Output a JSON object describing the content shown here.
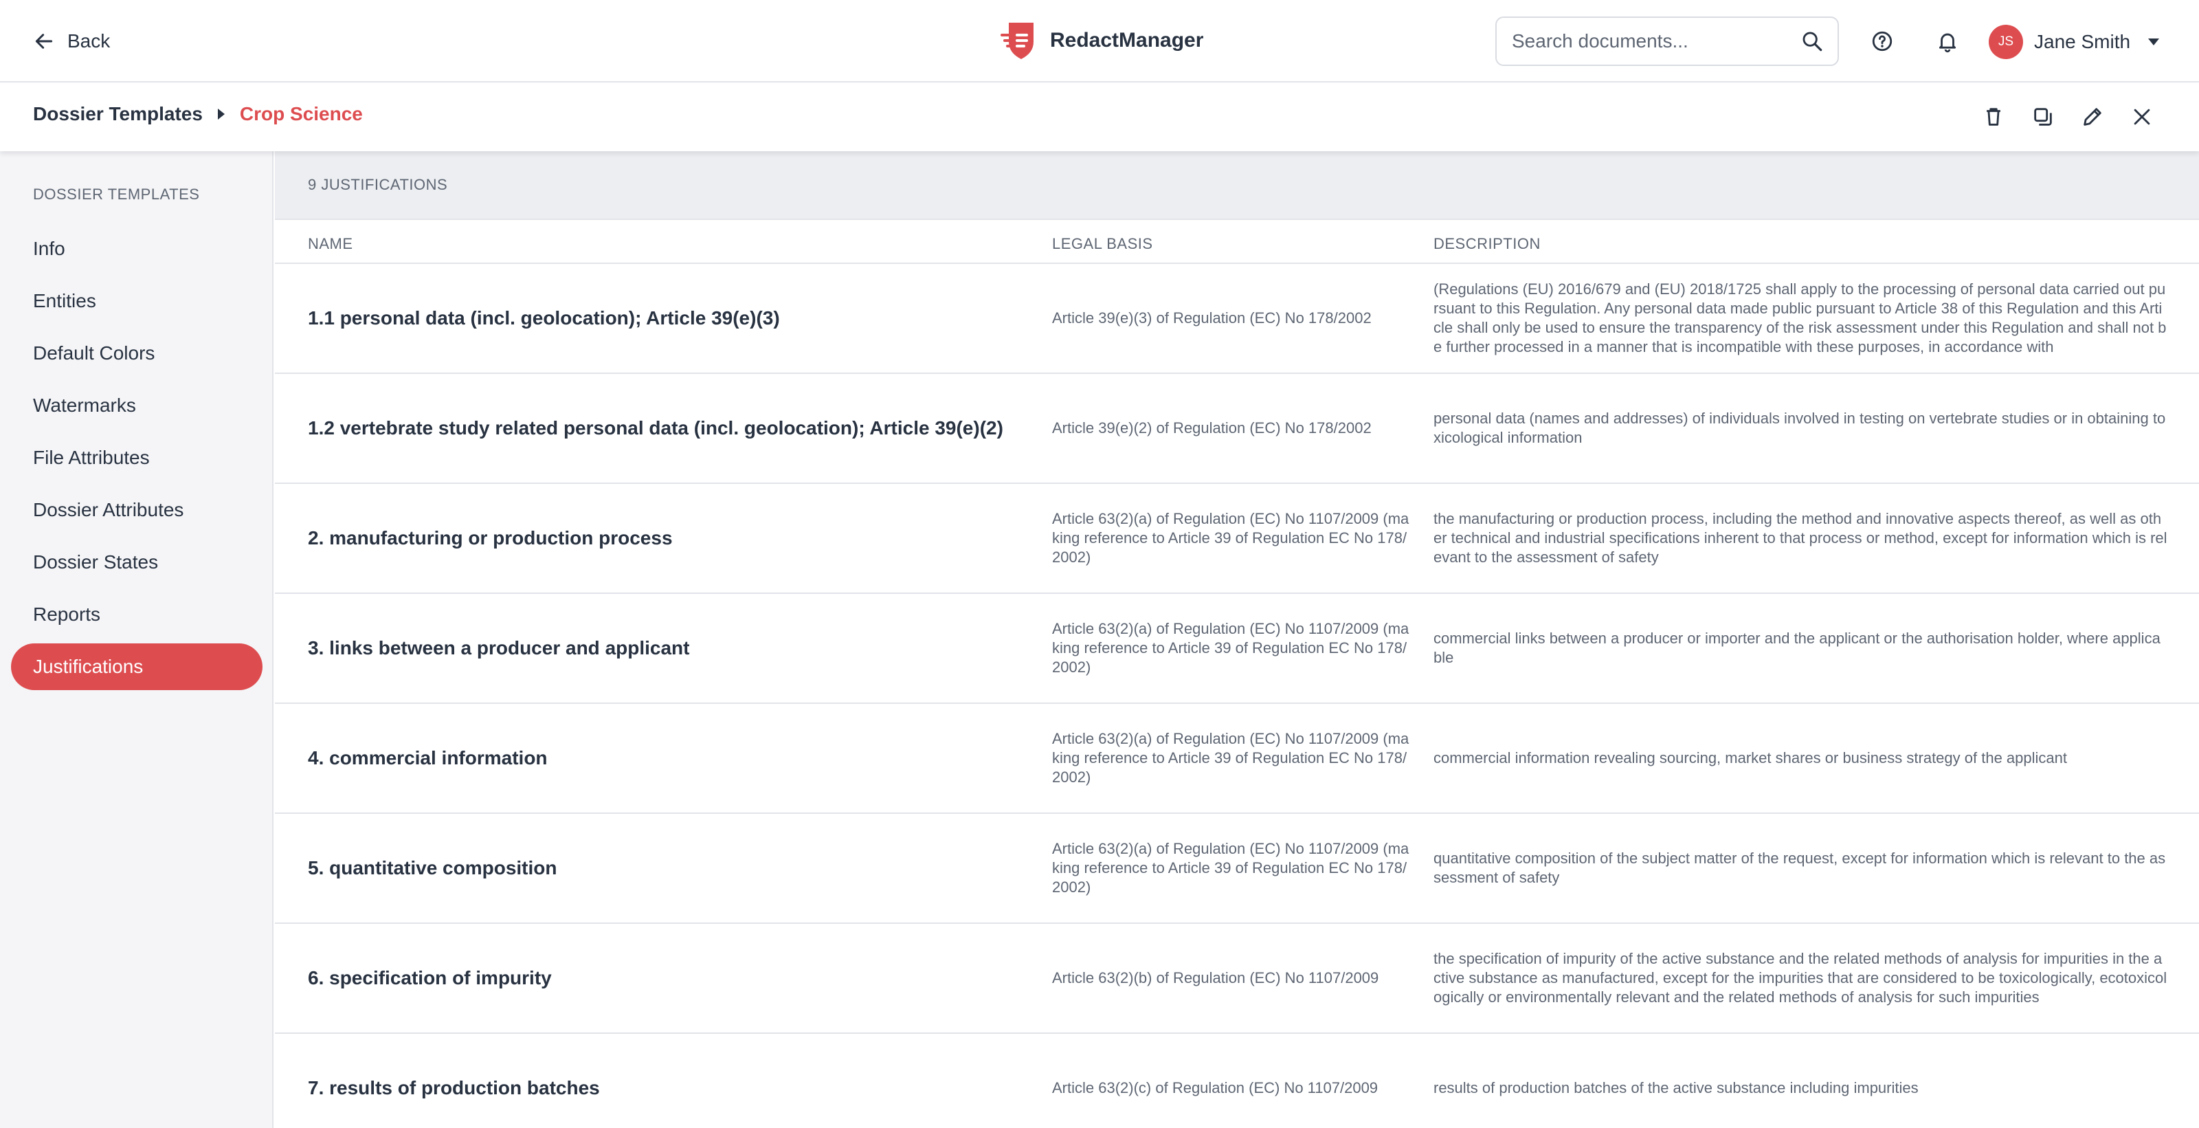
{
  "header": {
    "back_label": "Back",
    "brand_name": "RedactManager",
    "search_placeholder": "Search documents...",
    "user": {
      "initials": "JS",
      "name": "Jane Smith"
    },
    "accent_color": "#dd4d50"
  },
  "breadcrumb": {
    "root": "Dossier Templates",
    "current": "Crop Science"
  },
  "toolbar_icons": [
    "trash-icon",
    "copy-icon",
    "pencil-icon",
    "close-icon"
  ],
  "sidebar": {
    "title": "DOSSIER TEMPLATES",
    "items": [
      {
        "label": "Info",
        "active": false
      },
      {
        "label": "Entities",
        "active": false
      },
      {
        "label": "Default Colors",
        "active": false
      },
      {
        "label": "Watermarks",
        "active": false
      },
      {
        "label": "File Attributes",
        "active": false
      },
      {
        "label": "Dossier Attributes",
        "active": false
      },
      {
        "label": "Dossier States",
        "active": false
      },
      {
        "label": "Reports",
        "active": false
      },
      {
        "label": "Justifications",
        "active": true
      }
    ]
  },
  "main": {
    "count_label": "9 JUSTIFICATIONS",
    "columns": [
      "NAME",
      "LEGAL BASIS",
      "DESCRIPTION"
    ],
    "rows": [
      {
        "name": "1.1 personal data (incl. geolocation); Article 39(e)(3)",
        "legal_basis": "Article 39(e)(3) of Regulation (EC) No 178/2002",
        "description": "(Regulations (EU) 2016/679 and (EU) 2018/1725 shall apply to the processing of personal data carried out pursuant to this Regulation. Any personal data made public pursuant to Article 38 of this Regulation and this Article shall only be used to ensure the transparency of the risk assessment under this Regulation and shall not be further processed in a manner that is incompatible with these purposes, in accordance with"
      },
      {
        "name": "1.2 vertebrate study related personal data (incl. geolocation); Article 39(e)(2)",
        "legal_basis": "Article 39(e)(2) of Regulation (EC) No 178/2002",
        "description": "personal data (names and addresses) of individuals involved in testing on vertebrate studies or in obtaining toxicological information"
      },
      {
        "name": "2. manufacturing or production process",
        "legal_basis": "Article 63(2)(a) of Regulation (EC) No 1107/2009 (making reference to Article 39 of Regulation EC No 178/2002)",
        "description": "the manufacturing or production process, including the method and innovative aspects thereof, as well as other technical and industrial specifications inherent to that process or method, except for information which is relevant to the assessment of safety"
      },
      {
        "name": "3. links between a producer and applicant",
        "legal_basis": "Article 63(2)(a) of Regulation (EC) No 1107/2009 (making reference to Article 39 of Regulation EC No 178/2002)",
        "description": "commercial links between a producer or importer and the applicant or the authorisation holder, where applicable"
      },
      {
        "name": "4. commercial information",
        "legal_basis": "Article 63(2)(a) of Regulation (EC) No 1107/2009 (making reference to Article 39 of Regulation EC No 178/2002)",
        "description": "commercial information revealing sourcing, market shares or business strategy of the applicant"
      },
      {
        "name": "5. quantitative composition",
        "legal_basis": "Article 63(2)(a) of Regulation (EC) No 1107/2009 (making reference to Article 39 of Regulation EC No 178/2002)",
        "description": "quantitative composition of the subject matter of the request, except for information which is relevant to the assessment of safety"
      },
      {
        "name": "6. specification of impurity",
        "legal_basis": "Article 63(2)(b) of Regulation (EC) No 1107/2009",
        "description": "the specification of impurity of the active substance and the related methods of analysis for impurities in the active substance as manufactured, except for the impurities that are considered to be toxicologically, ecotoxicologically or environmentally relevant and the related methods of analysis for such impurities"
      },
      {
        "name": "7. results of production batches",
        "legal_basis": "Article 63(2)(c) of Regulation (EC) No 1107/2009",
        "description": "results of production batches of the active substance including impurities"
      }
    ]
  }
}
